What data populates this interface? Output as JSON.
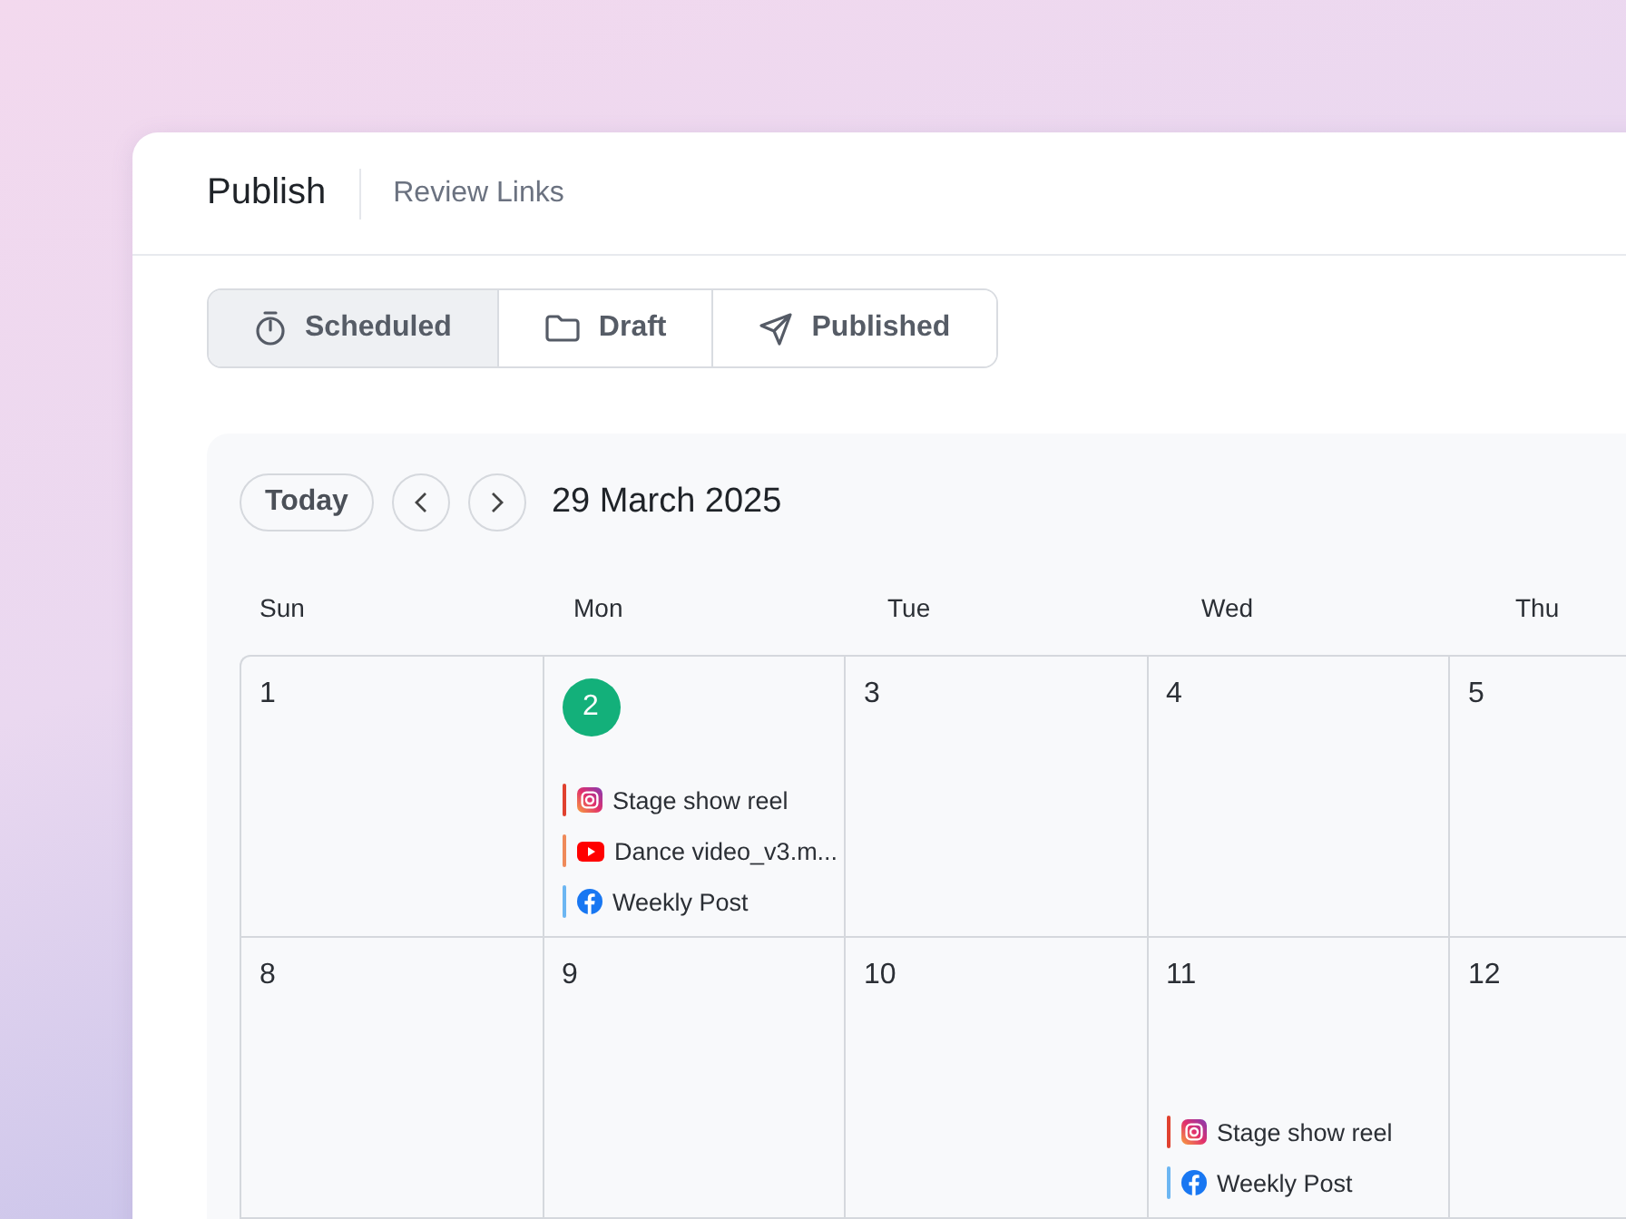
{
  "header_tabs": [
    {
      "label": "Publish",
      "selected": true
    },
    {
      "label": "Review Links",
      "selected": false
    }
  ],
  "view_tabs": [
    {
      "label": "Scheduled",
      "selected": true
    },
    {
      "label": "Draft",
      "selected": false
    },
    {
      "label": "Published",
      "selected": false
    }
  ],
  "calendar": {
    "today_button": "Today",
    "date": "29 March 2025",
    "weekdays": [
      "Sun",
      "Mon",
      "Tue",
      "Wed",
      "Thu"
    ],
    "days": [
      {
        "day": "1",
        "today": false
      },
      {
        "day": "2",
        "today": true,
        "events": [
          {
            "kind": "instagram",
            "title": "Stage show reel",
            "color": "#e0412f"
          },
          {
            "kind": "youtube",
            "title": "Dance video_v3.m...",
            "color": "#ef8a5a"
          },
          {
            "kind": "facebook",
            "title": "Weekly Post",
            "color": "#6cb6f2"
          }
        ]
      },
      {
        "day": "3",
        "today": false
      },
      {
        "day": "4",
        "today": false
      },
      {
        "day": "5",
        "today": false
      },
      {
        "day": "8",
        "today": false
      },
      {
        "day": "9",
        "today": false
      },
      {
        "day": "10",
        "today": false
      },
      {
        "day": "11",
        "today": false,
        "events": [
          {
            "kind": "instagram",
            "title": "Stage show reel",
            "color": "#e0412f"
          },
          {
            "kind": "facebook",
            "title": "Weekly Post",
            "color": "#6cb6f2"
          }
        ]
      },
      {
        "day": "12",
        "today": false
      }
    ]
  }
}
